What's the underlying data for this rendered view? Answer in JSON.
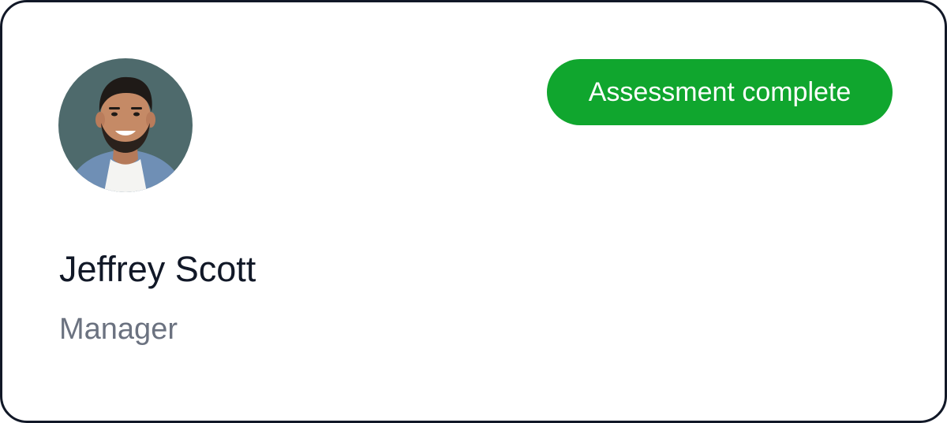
{
  "profile": {
    "name": "Jeffrey Scott",
    "role": "Manager",
    "avatar_icon": "person-avatar"
  },
  "status": {
    "label": "Assessment complete",
    "color": "#10a62e"
  }
}
